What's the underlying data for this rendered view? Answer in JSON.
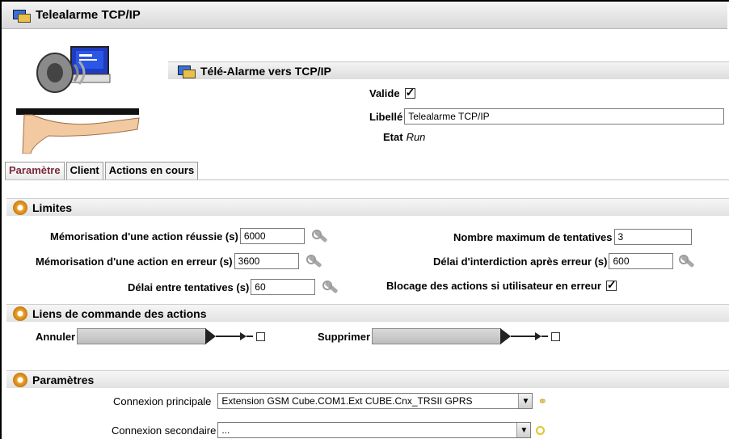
{
  "window": {
    "title": "Telealarme TCP/IP"
  },
  "header": {
    "section_title": "Télé-Alarme vers TCP/IP",
    "valide_label": "Valide",
    "valide_checked": true,
    "libelle_label": "Libellé",
    "libelle_value": "Telealarme TCP/IP",
    "etat_label": "Etat",
    "etat_value": "Run"
  },
  "tabs": [
    "Paramètre",
    "Client",
    "Actions en cours"
  ],
  "limites": {
    "title": "Limites",
    "memo_reussie_label": "Mémorisation d'une action réussie (s)",
    "memo_reussie_value": "6000",
    "memo_erreur_label": "Mémorisation d'une action en erreur (s)",
    "memo_erreur_value": "3600",
    "delai_tentatives_label": "Délai entre tentatives (s)",
    "delai_tentatives_value": "60",
    "nb_max_label": "Nombre maximum de tentatives",
    "nb_max_value": "3",
    "delai_interdiction_label": "Délai d'interdiction après erreur (s)",
    "delai_interdiction_value": "600",
    "blocage_label": "Blocage des actions si utilisateur en erreur",
    "blocage_checked": true
  },
  "liens": {
    "title": "Liens de commande des actions",
    "annuler_label": "Annuler",
    "supprimer_label": "Supprimer"
  },
  "parametres": {
    "title": "Paramètres",
    "principale_label": "Connexion principale",
    "principale_value": "Extension GSM Cube.COM1.Ext CUBE.Cnx_TRSII GPRS",
    "secondaire_label": "Connexion secondaire",
    "secondaire_value": "..."
  }
}
